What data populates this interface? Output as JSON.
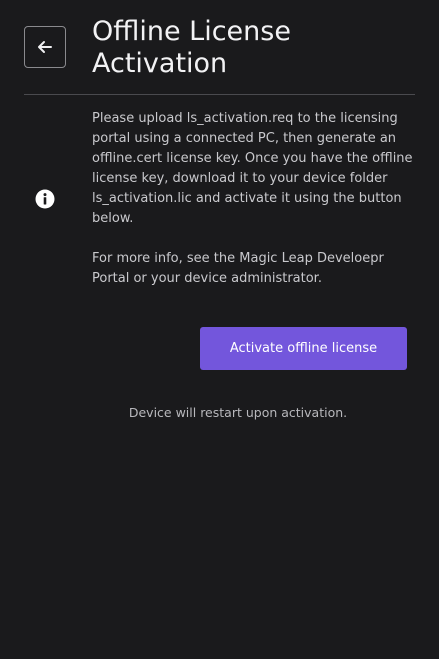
{
  "header": {
    "title": "Offline License Activation",
    "back_icon": "arrow-left-icon"
  },
  "info": {
    "icon": "info-icon",
    "paragraph1": "Please upload ls_activation.req to the licensing portal using a  connected PC, then generate an offline.cert license key. Once you have the offline license key, download it to your device folder ls_activation.lic and activate it using the button below.",
    "paragraph2": "For more info, see the Magic Leap Develoepr Portal or your device administrator."
  },
  "actions": {
    "activate_label": "Activate offline license"
  },
  "footer": {
    "note": "Device will restart upon activation."
  },
  "colors": {
    "background": "#1a1a1c",
    "accent": "#7356dc"
  }
}
